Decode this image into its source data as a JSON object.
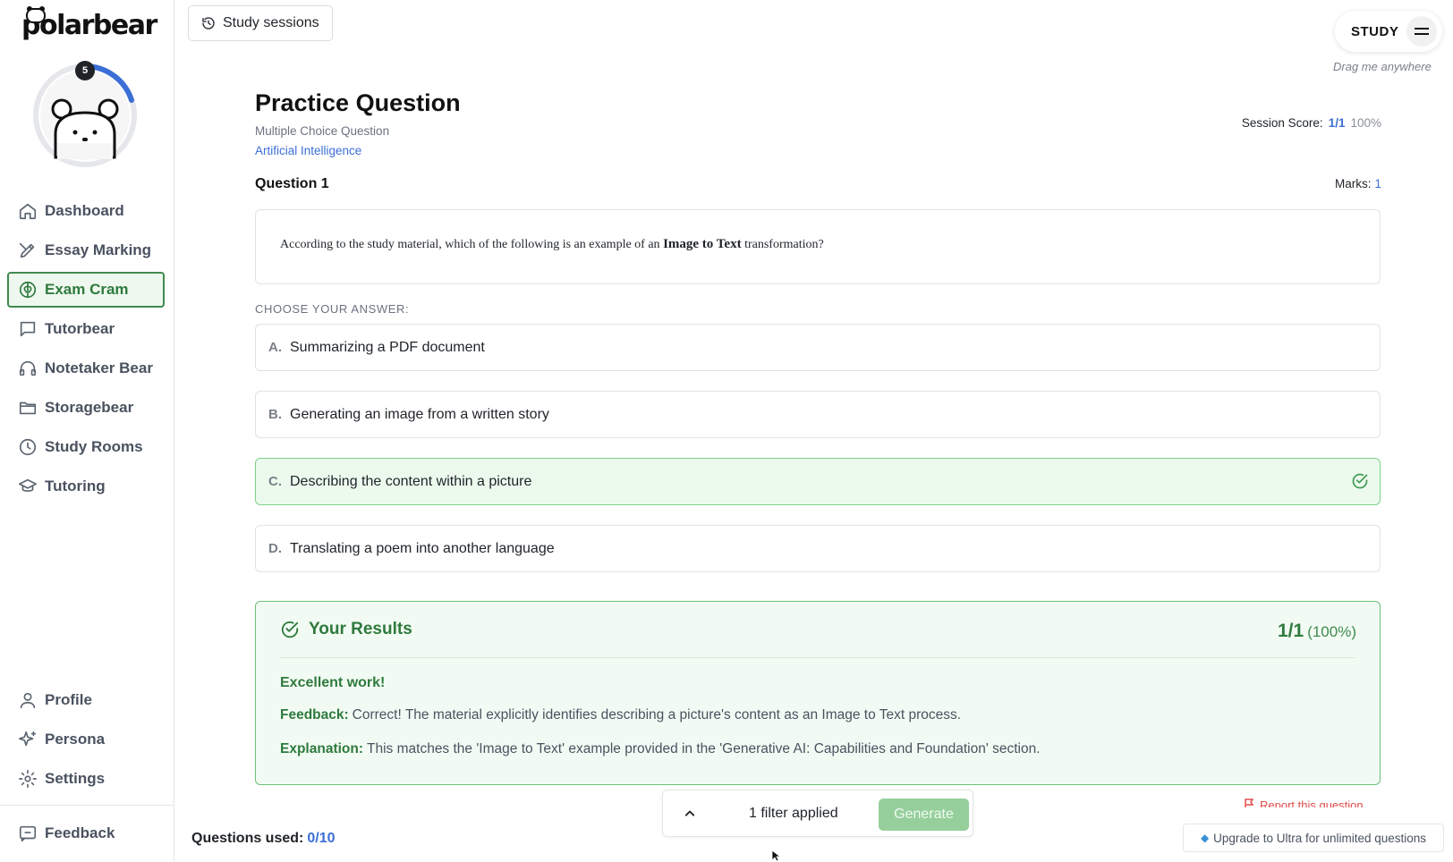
{
  "brand": {
    "logo_text": "polarbear"
  },
  "avatar": {
    "level": "5",
    "progress_fraction": 0.3
  },
  "sidebar": {
    "items": [
      {
        "id": "dashboard",
        "label": "Dashboard",
        "icon": "home-icon"
      },
      {
        "id": "essay-marking",
        "label": "Essay Marking",
        "icon": "pen-icon"
      },
      {
        "id": "exam-cram",
        "label": "Exam Cram",
        "icon": "brain-icon",
        "active": true
      },
      {
        "id": "tutorbear",
        "label": "Tutorbear",
        "icon": "chat-icon"
      },
      {
        "id": "notetaker-bear",
        "label": "Notetaker Bear",
        "icon": "headphones-icon"
      },
      {
        "id": "storagebear",
        "label": "Storagebear",
        "icon": "folder-icon"
      },
      {
        "id": "study-rooms",
        "label": "Study Rooms",
        "icon": "clock-icon"
      },
      {
        "id": "tutoring",
        "label": "Tutoring",
        "icon": "graduation-cap-icon"
      }
    ],
    "bottom_items": [
      {
        "id": "profile",
        "label": "Profile",
        "icon": "user-icon"
      },
      {
        "id": "persona",
        "label": "Persona",
        "icon": "sparkles-icon"
      },
      {
        "id": "settings",
        "label": "Settings",
        "icon": "gear-icon"
      }
    ],
    "feedback": {
      "label": "Feedback",
      "icon": "message-square-icon"
    }
  },
  "topbar": {
    "sessions_label": "Study sessions",
    "study_label": "STUDY",
    "drag_hint": "Drag me anywhere"
  },
  "question": {
    "title": "Practice Question",
    "type": "Multiple Choice Question",
    "subject": "Artificial Intelligence",
    "score_label": "Session Score:",
    "score_value": "1/1",
    "score_pct": "100%",
    "number_label": "Question 1",
    "marks_label": "Marks:",
    "marks_value": "1",
    "text_before": "According to the study material, which of the following is an example of an ",
    "text_bold": "Image to Text",
    "text_after": " transformation?",
    "choose_label": "CHOOSE YOUR ANSWER:",
    "options": [
      {
        "letter": "A.",
        "text": "Summarizing a PDF document"
      },
      {
        "letter": "B.",
        "text": "Generating an image from a written story"
      },
      {
        "letter": "C.",
        "text": "Describing the content within a picture",
        "correct": true
      },
      {
        "letter": "D.",
        "text": "Translating a poem into another language"
      }
    ]
  },
  "results": {
    "title": "Your Results",
    "score": "1/1",
    "score_pct": "(100%)",
    "headline": "Excellent work!",
    "feedback_label": "Feedback:",
    "feedback_text": "Correct! The material explicitly identifies describing a picture's content as an Image to Text process.",
    "explanation_label": "Explanation:",
    "explanation_text": "This matches the 'Image to Text' example provided in the 'Generative AI: Capabilities and Foundation' section."
  },
  "footer": {
    "filter_text": "1 filter applied",
    "generate_label": "Generate",
    "report_label": "Report this question",
    "used_label": "Questions used:",
    "used_value": "0/10",
    "upgrade_label": "Upgrade to Ultra for unlimited questions"
  },
  "colors": {
    "accent_green": "#2f7a3e",
    "accent_blue": "#3b6fd6",
    "correct_bg": "#ecfaee"
  }
}
